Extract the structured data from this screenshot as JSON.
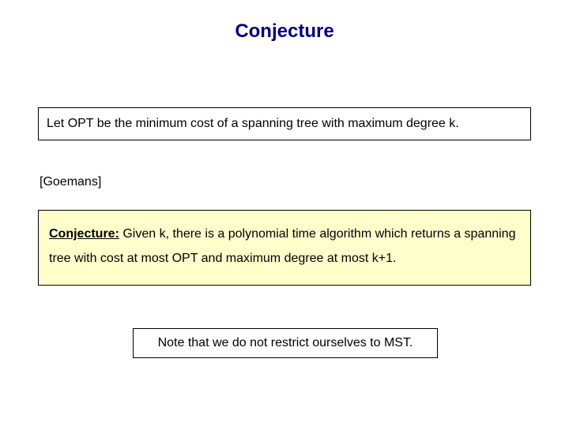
{
  "title": "Conjecture",
  "box1": "Let OPT be the minimum cost of a spanning tree with maximum degree k.",
  "citation": "[Goemans]",
  "box2": {
    "label": "Conjecture:",
    "text": " Given k, there is a polynomial time algorithm which returns a spanning tree with cost at most OPT and maximum degree at most k+1."
  },
  "box3": "Note that we do not restrict ourselves to MST."
}
